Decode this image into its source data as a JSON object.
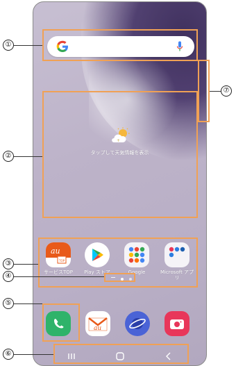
{
  "weather": {
    "text": "タップして天気情報を表示"
  },
  "apps_row1": [
    {
      "name": "サービスTOP",
      "icon": "au-service-top-icon"
    },
    {
      "name": "Play ストア",
      "icon": "play-store-icon"
    },
    {
      "name": "Google",
      "icon": "google-folder-icon"
    },
    {
      "name": "Microsoft アプリ",
      "icon": "microsoft-folder-icon"
    }
  ],
  "dock": [
    {
      "icon": "phone-icon"
    },
    {
      "icon": "au-mail-icon"
    },
    {
      "icon": "internet-icon"
    },
    {
      "icon": "camera-icon"
    }
  ],
  "navbar": {
    "recent": "recents-icon",
    "home": "home-icon",
    "back": "back-icon"
  },
  "callouts": [
    "①",
    "②",
    "③",
    "④",
    "⑤",
    "⑥",
    "⑦"
  ],
  "colors": {
    "accent_orange": "#f0a155",
    "phone_green": "#2fb36a",
    "play_blue": "#1fa463",
    "camera_red": "#e8365a",
    "au_orange": "#e85a1a"
  }
}
